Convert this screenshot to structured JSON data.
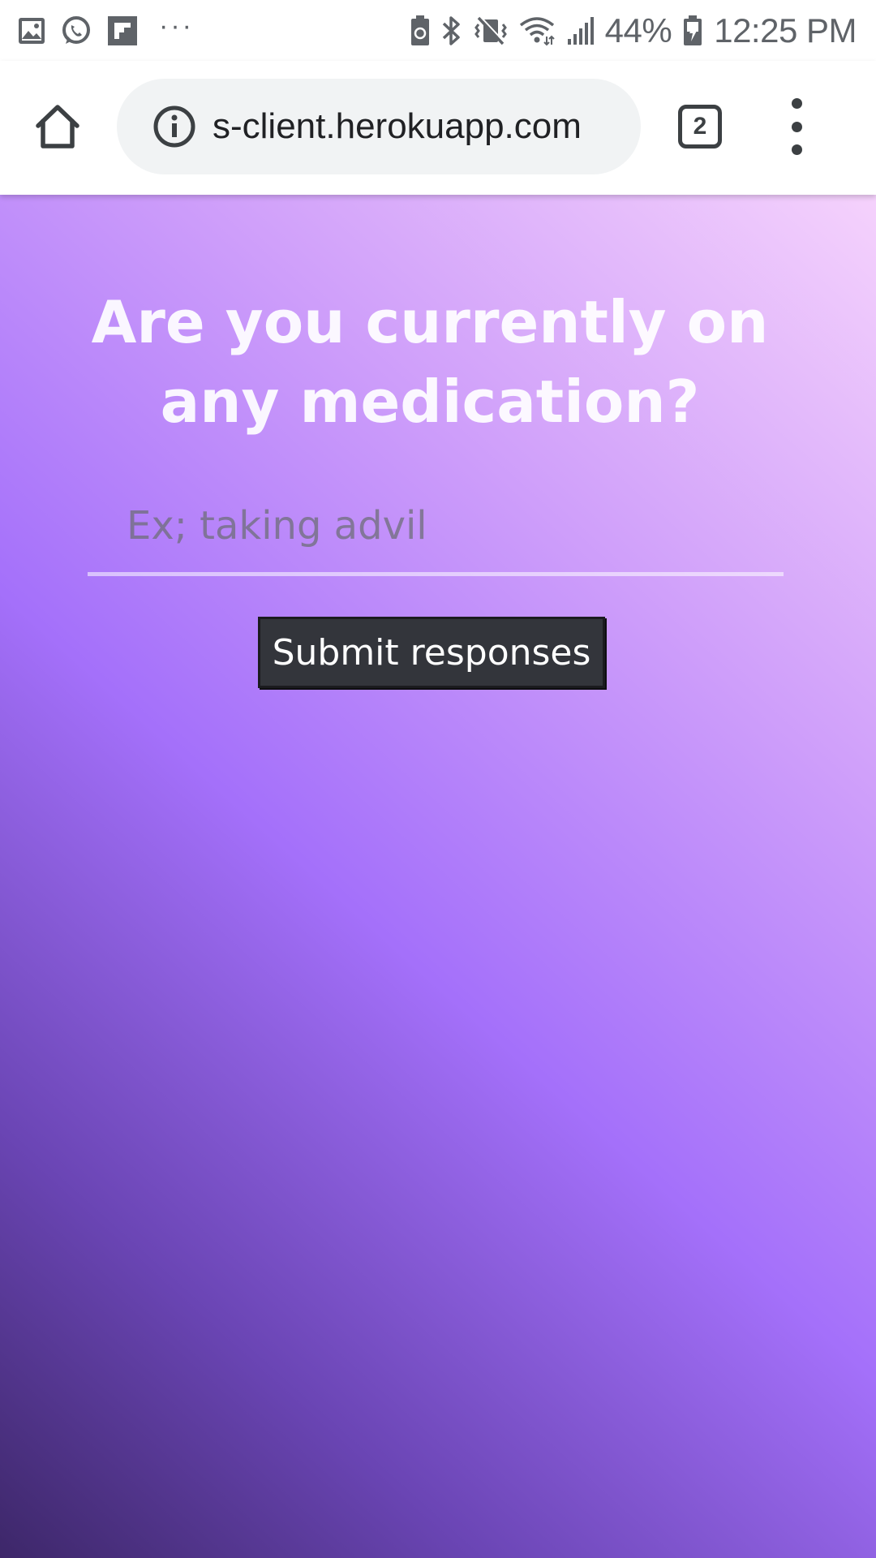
{
  "status_bar": {
    "left_icons": [
      "gallery-icon",
      "whatsapp-icon",
      "flipboard-icon"
    ],
    "more_indicator": "···",
    "right_icons": [
      "battery-saver-icon",
      "bluetooth-icon",
      "vibrate-icon",
      "wifi-icon",
      "signal-icon",
      "battery-icon"
    ],
    "battery": "44%",
    "time": "12:25 PM"
  },
  "browser": {
    "url": "s-client.herokuapp.com",
    "tab_count": "2",
    "icons": {
      "home": "home-icon",
      "info": "info-icon",
      "menu": "more-vert-icon"
    }
  },
  "form": {
    "question": "Are you currently on any medication?",
    "input_value": "",
    "input_placeholder": "Ex; taking advil",
    "submit_label": "Submit responses"
  },
  "colors": {
    "gradient_dark": "#3d2769",
    "gradient_mid": "#a470fa",
    "gradient_light": "#f5d2fc",
    "button_bg": "#33353b",
    "url_bar_bg": "#f1f3f4"
  }
}
